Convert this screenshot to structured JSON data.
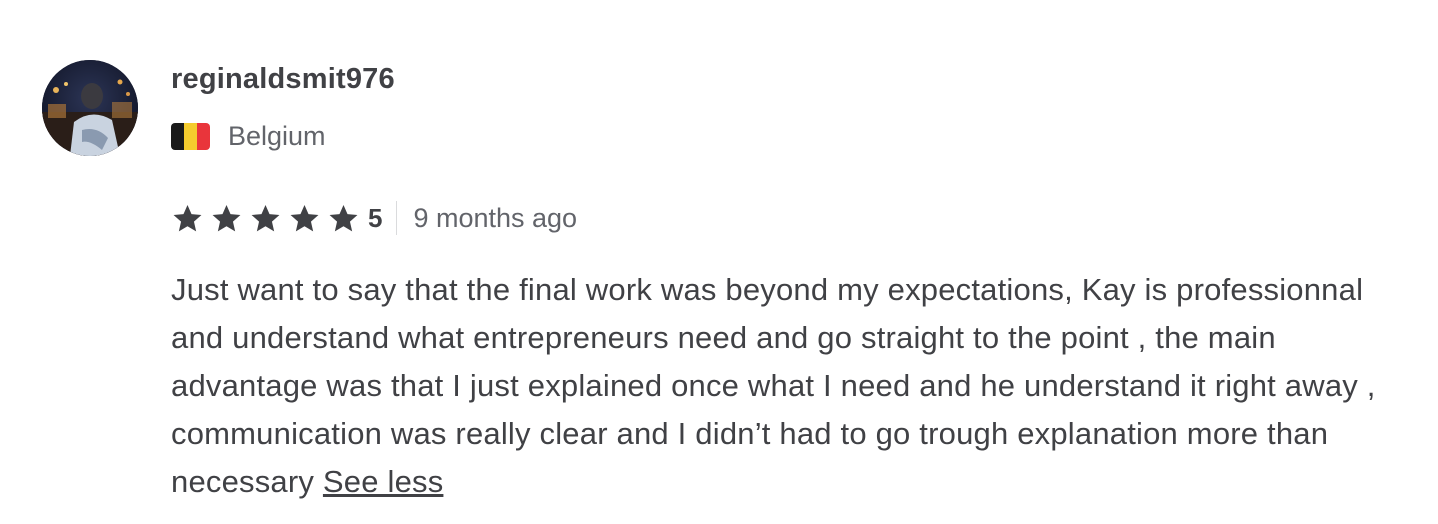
{
  "review": {
    "username": "reginaldsmit976",
    "country": "Belgium",
    "flag_colors": [
      "#1a1a1a",
      "#f5cc2e",
      "#e9353b"
    ],
    "avatar_icon": "user-avatar-photo",
    "rating": {
      "stars": 5,
      "value": "5",
      "star_color": "#404145"
    },
    "time_ago": "9 months ago",
    "text": "Just want to say that the final work was beyond my expectations, Kay is professionnal and understand what entrepreneurs need and go straight to the point , the main advantage was that I just explained once what I need and he understand it right away , communication was really clear and I didn’t had to go trough explanation more than necessary",
    "see_less_label": "See less"
  }
}
